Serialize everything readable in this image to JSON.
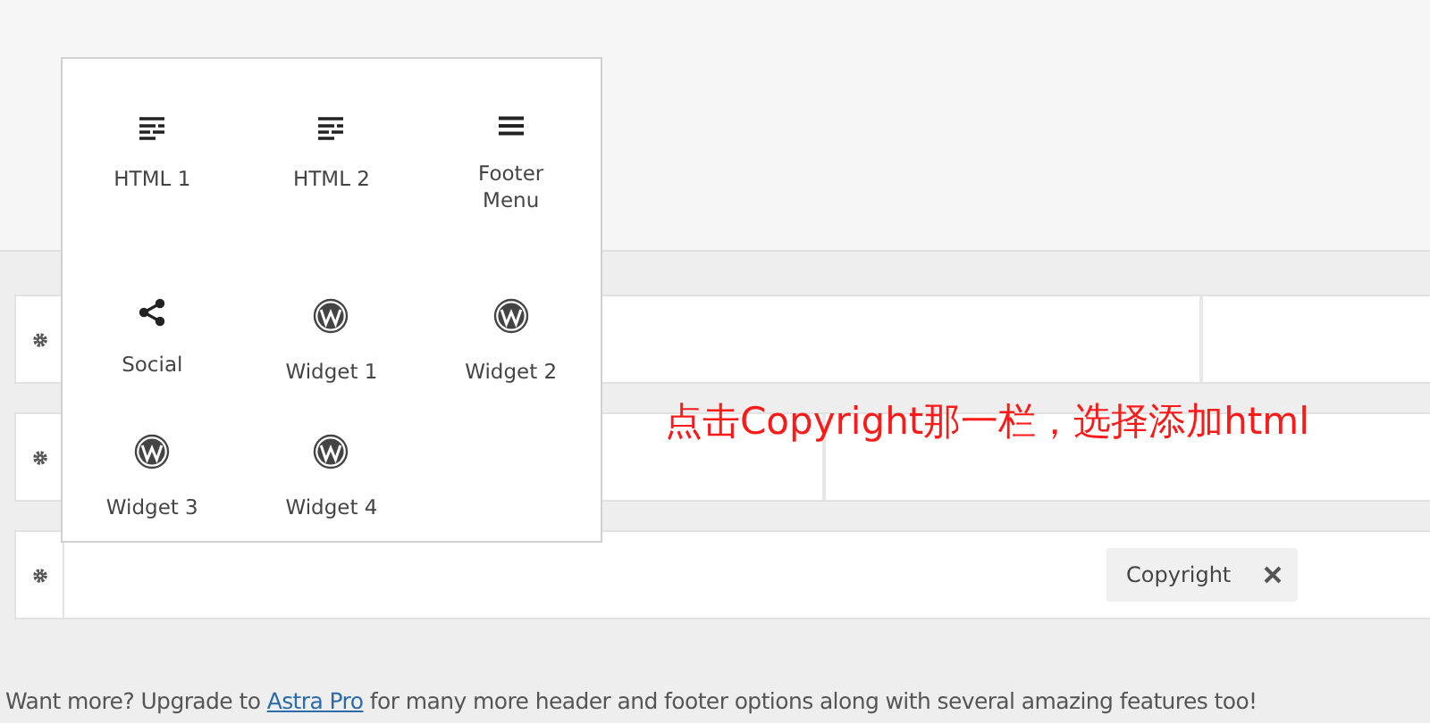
{
  "rows": [
    {
      "kind": "split-right"
    },
    {
      "kind": "split-middle"
    },
    {
      "kind": "chip",
      "chip": {
        "label": "Copyright"
      }
    }
  ],
  "popover": {
    "items": [
      {
        "label": "HTML 1",
        "kind": "html"
      },
      {
        "label": "HTML 2",
        "kind": "html"
      },
      {
        "label": "Footer Menu",
        "kind": "menu"
      },
      {
        "label": "Social",
        "kind": "social"
      },
      {
        "label": "Widget 1",
        "kind": "widget"
      },
      {
        "label": "Widget 2",
        "kind": "widget"
      },
      {
        "label": "Widget 3",
        "kind": "widget"
      },
      {
        "label": "Widget 4",
        "kind": "widget"
      }
    ]
  },
  "annotation": "点击Copyright那一栏，选择添加html",
  "footer": {
    "before": "Want more? Upgrade to ",
    "link": "Astra Pro",
    "after": " for many more header and footer options along with several amazing features too!"
  }
}
